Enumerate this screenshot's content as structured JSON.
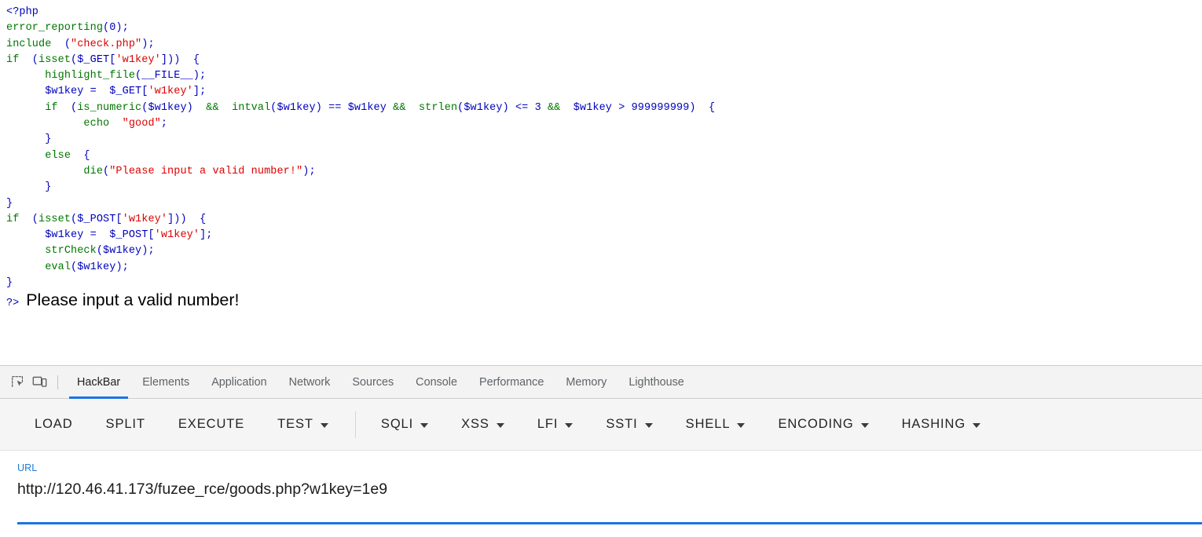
{
  "page": {
    "code_lines": [
      [
        {
          "t": "<?php",
          "c": "c-def"
        }
      ],
      [
        {
          "t": "error_reporting",
          "c": "c-kw"
        },
        {
          "t": "(0);",
          "c": "c-def"
        }
      ],
      [
        {
          "t": "include ",
          "c": "c-kw"
        },
        {
          "t": " (",
          "c": "c-def"
        },
        {
          "t": "\"check.php\"",
          "c": "c-str"
        },
        {
          "t": ");",
          "c": "c-def"
        }
      ],
      [
        {
          "t": "if ",
          "c": "c-kw"
        },
        {
          "t": " (",
          "c": "c-def"
        },
        {
          "t": "isset",
          "c": "c-kw"
        },
        {
          "t": "($_GET[",
          "c": "c-def"
        },
        {
          "t": "'w1key'",
          "c": "c-str"
        },
        {
          "t": "])) ",
          "c": "c-def"
        },
        {
          "t": " {",
          "c": "c-def"
        }
      ],
      [
        {
          "t": "      ",
          "c": "c-def"
        },
        {
          "t": "highlight_file",
          "c": "c-kw"
        },
        {
          "t": "(__FILE__);",
          "c": "c-def"
        }
      ],
      [
        {
          "t": "      $w1key = ",
          "c": "c-def"
        },
        {
          "t": " $_GET[",
          "c": "c-def"
        },
        {
          "t": "'w1key'",
          "c": "c-str"
        },
        {
          "t": "];",
          "c": "c-def"
        }
      ],
      [
        {
          "t": "      ",
          "c": "c-def"
        },
        {
          "t": "if ",
          "c": "c-kw"
        },
        {
          "t": " (",
          "c": "c-def"
        },
        {
          "t": "is_numeric",
          "c": "c-kw"
        },
        {
          "t": "($w1key) ",
          "c": "c-def"
        },
        {
          "t": " && ",
          "c": "c-kw"
        },
        {
          "t": " ",
          "c": "c-def"
        },
        {
          "t": "intval",
          "c": "c-kw"
        },
        {
          "t": "($w1key) == $w1key ",
          "c": "c-def"
        },
        {
          "t": "&& ",
          "c": "c-kw"
        },
        {
          "t": " ",
          "c": "c-def"
        },
        {
          "t": "strlen",
          "c": "c-kw"
        },
        {
          "t": "($w1key) <= 3 ",
          "c": "c-def"
        },
        {
          "t": "&& ",
          "c": "c-kw"
        },
        {
          "t": " $w1key > 999999999) ",
          "c": "c-def"
        },
        {
          "t": " {",
          "c": "c-def"
        }
      ],
      [
        {
          "t": "            ",
          "c": "c-def"
        },
        {
          "t": "echo ",
          "c": "c-kw"
        },
        {
          "t": " ",
          "c": "c-def"
        },
        {
          "t": "\"good\"",
          "c": "c-str"
        },
        {
          "t": ";",
          "c": "c-def"
        }
      ],
      [
        {
          "t": "      }",
          "c": "c-def"
        }
      ],
      [
        {
          "t": "      ",
          "c": "c-def"
        },
        {
          "t": "else ",
          "c": "c-kw"
        },
        {
          "t": " {",
          "c": "c-def"
        }
      ],
      [
        {
          "t": "            ",
          "c": "c-def"
        },
        {
          "t": "die",
          "c": "c-kw"
        },
        {
          "t": "(",
          "c": "c-def"
        },
        {
          "t": "\"Please input a valid number!\"",
          "c": "c-str"
        },
        {
          "t": ");",
          "c": "c-def"
        }
      ],
      [
        {
          "t": "      }",
          "c": "c-def"
        }
      ],
      [
        {
          "t": "}",
          "c": "c-def"
        }
      ],
      [
        {
          "t": "if ",
          "c": "c-kw"
        },
        {
          "t": " (",
          "c": "c-def"
        },
        {
          "t": "isset",
          "c": "c-kw"
        },
        {
          "t": "($_POST[",
          "c": "c-def"
        },
        {
          "t": "'w1key'",
          "c": "c-str"
        },
        {
          "t": "])) ",
          "c": "c-def"
        },
        {
          "t": " {",
          "c": "c-def"
        }
      ],
      [
        {
          "t": "      $w1key = ",
          "c": "c-def"
        },
        {
          "t": " $_POST[",
          "c": "c-def"
        },
        {
          "t": "'w1key'",
          "c": "c-str"
        },
        {
          "t": "];",
          "c": "c-def"
        }
      ],
      [
        {
          "t": "      ",
          "c": "c-def"
        },
        {
          "t": "strCheck",
          "c": "c-kw"
        },
        {
          "t": "($w1key);",
          "c": "c-def"
        }
      ],
      [
        {
          "t": "      ",
          "c": "c-def"
        },
        {
          "t": "eval",
          "c": "c-kw"
        },
        {
          "t": "($w1key);",
          "c": "c-def"
        }
      ],
      [
        {
          "t": "}",
          "c": "c-def"
        }
      ]
    ],
    "php_close_tag": "?>",
    "die_message": "Please input a valid number!"
  },
  "devtools": {
    "inspect_icon": "inspect-element-icon",
    "device_icon": "device-toolbar-icon",
    "tabs": [
      {
        "label": "HackBar",
        "active": true
      },
      {
        "label": "Elements",
        "active": false
      },
      {
        "label": "Application",
        "active": false
      },
      {
        "label": "Network",
        "active": false
      },
      {
        "label": "Sources",
        "active": false
      },
      {
        "label": "Console",
        "active": false
      },
      {
        "label": "Performance",
        "active": false
      },
      {
        "label": "Memory",
        "active": false
      },
      {
        "label": "Lighthouse",
        "active": false
      }
    ],
    "active_tab": "HackBar",
    "accent_color": "#1a73e8"
  },
  "hackbar": {
    "buttons": [
      {
        "label": "LOAD",
        "has_dropdown": false
      },
      {
        "label": "SPLIT",
        "has_dropdown": false
      },
      {
        "label": "EXECUTE",
        "has_dropdown": false
      },
      {
        "label": "TEST",
        "has_dropdown": true
      },
      {
        "label": "SQLI",
        "has_dropdown": true
      },
      {
        "label": "XSS",
        "has_dropdown": true
      },
      {
        "label": "LFI",
        "has_dropdown": true
      },
      {
        "label": "SSTI",
        "has_dropdown": true
      },
      {
        "label": "SHELL",
        "has_dropdown": true
      },
      {
        "label": "ENCODING",
        "has_dropdown": true
      },
      {
        "label": "HASHING",
        "has_dropdown": true
      }
    ],
    "separator_after_index": 3,
    "url_field": {
      "label": "URL",
      "value": "http://120.46.41.173/fuzee_rce/goods.php?w1key=1e9",
      "placeholder": "http://"
    }
  }
}
